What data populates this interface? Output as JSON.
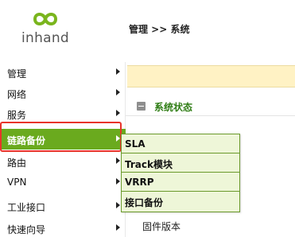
{
  "header": {
    "logo_text": "inhand",
    "breadcrumb": "管理 >> 系统"
  },
  "sidebar": {
    "items": [
      {
        "label": "管理"
      },
      {
        "label": "网络"
      },
      {
        "label": "服务"
      },
      {
        "label": "链路备份",
        "active": true
      },
      {
        "label": "路由"
      },
      {
        "label": "VPN"
      },
      {
        "label": "工业接口"
      },
      {
        "label": "快速向导"
      }
    ]
  },
  "submenu": {
    "items": [
      {
        "label": "SLA"
      },
      {
        "label": "Track模块"
      },
      {
        "label": "VRRP"
      },
      {
        "label": "接口备份"
      }
    ]
  },
  "main": {
    "section_title": "系统状态",
    "firmware_label": "固件版本"
  },
  "colors": {
    "accent_green": "#6aaa1e",
    "section_title_green": "#2f7d15",
    "highlight_red": "#e8342a",
    "yellow_bar": "#fff2c4",
    "submenu_bg": "#eef6d8"
  }
}
